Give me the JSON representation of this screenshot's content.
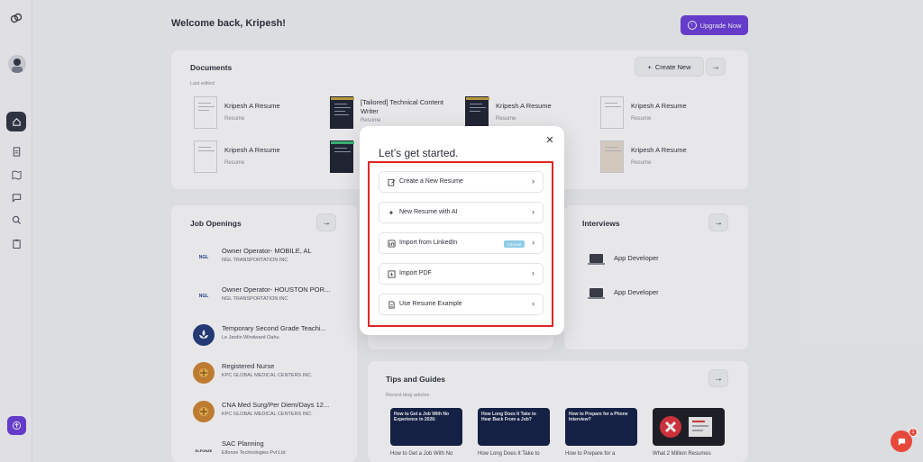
{
  "header": {
    "welcome": "Welcome back, Kripesh!",
    "upgrade_label": "Upgrade Now"
  },
  "documents": {
    "title": "Documents",
    "create_label": "Create New",
    "subtitle": "Last edited",
    "items": [
      {
        "name": "Kripesh A Resume",
        "type": "Resume"
      },
      {
        "name": "[Tailored] Technical Content Writer",
        "type": "Resume"
      },
      {
        "name": "Kripesh A Resume",
        "type": "Resume"
      },
      {
        "name": "Kripesh A Resume",
        "type": "Resume"
      },
      {
        "name": "Kripesh A Resume",
        "type": "Resume"
      },
      {
        "name": "Kripesh A Resume",
        "type": "Resume"
      }
    ]
  },
  "jobs": {
    "title": "Job Openings",
    "items": [
      {
        "title": "Owner Operator- MOBILE, AL",
        "company": "NGL TRANSPORTATION INC",
        "logo": "NGL"
      },
      {
        "title": "Owner Operator- HOUSTON POR...",
        "company": "NGL TRANSPORTATION INC",
        "logo": "NGL"
      },
      {
        "title": "Temporary Second Grade Teachi...",
        "company": "Le Jardin Windward Oahu",
        "logo": ""
      },
      {
        "title": "Registered Nurse",
        "company": "KPC GLOBAL MEDICAL CENTERS INC.",
        "logo": ""
      },
      {
        "title": "CNA Med Surg/Per Diem/Days 12...",
        "company": "KPC GLOBAL MEDICAL CENTERS INC.",
        "logo": ""
      },
      {
        "title": "SAC Planning",
        "company": "Elfonze Technologies Pvt Ltd",
        "logo": "ELFONZE"
      }
    ]
  },
  "interviews": {
    "title": "Interviews",
    "items": [
      "App Developer",
      "App Developer"
    ]
  },
  "tips": {
    "title": "Tips and Guides",
    "subtitle": "Recent blog articles",
    "articles": [
      {
        "image_text": "How to Get a Job With No Experience in 2026:",
        "caption": "How to Get a Job With No"
      },
      {
        "image_text": "How Long Does It Take to Hear Back From a Job?",
        "caption": "How Long Does It Take to"
      },
      {
        "image_text": "How to Prepare for a Phone Interview?",
        "caption": "How to Prepare for a"
      },
      {
        "image_text": "",
        "caption": "What 2 Million Resumes"
      }
    ]
  },
  "modal": {
    "title": "Let’s get started.",
    "options": [
      {
        "label": "Create a New Resume",
        "icon": "edit-icon"
      },
      {
        "label": "New Resume with AI",
        "icon": "sparkles-icon"
      },
      {
        "label": "Import from LinkedIn",
        "icon": "linkedin-icon",
        "badge": "Chrome"
      },
      {
        "label": "Import PDF",
        "icon": "import-icon"
      },
      {
        "label": "Use Resume Example",
        "icon": "document-icon"
      }
    ]
  },
  "chat": {
    "count": "1"
  },
  "colors": {
    "accent": "#6c3cdb",
    "highlight": "#e02424"
  }
}
